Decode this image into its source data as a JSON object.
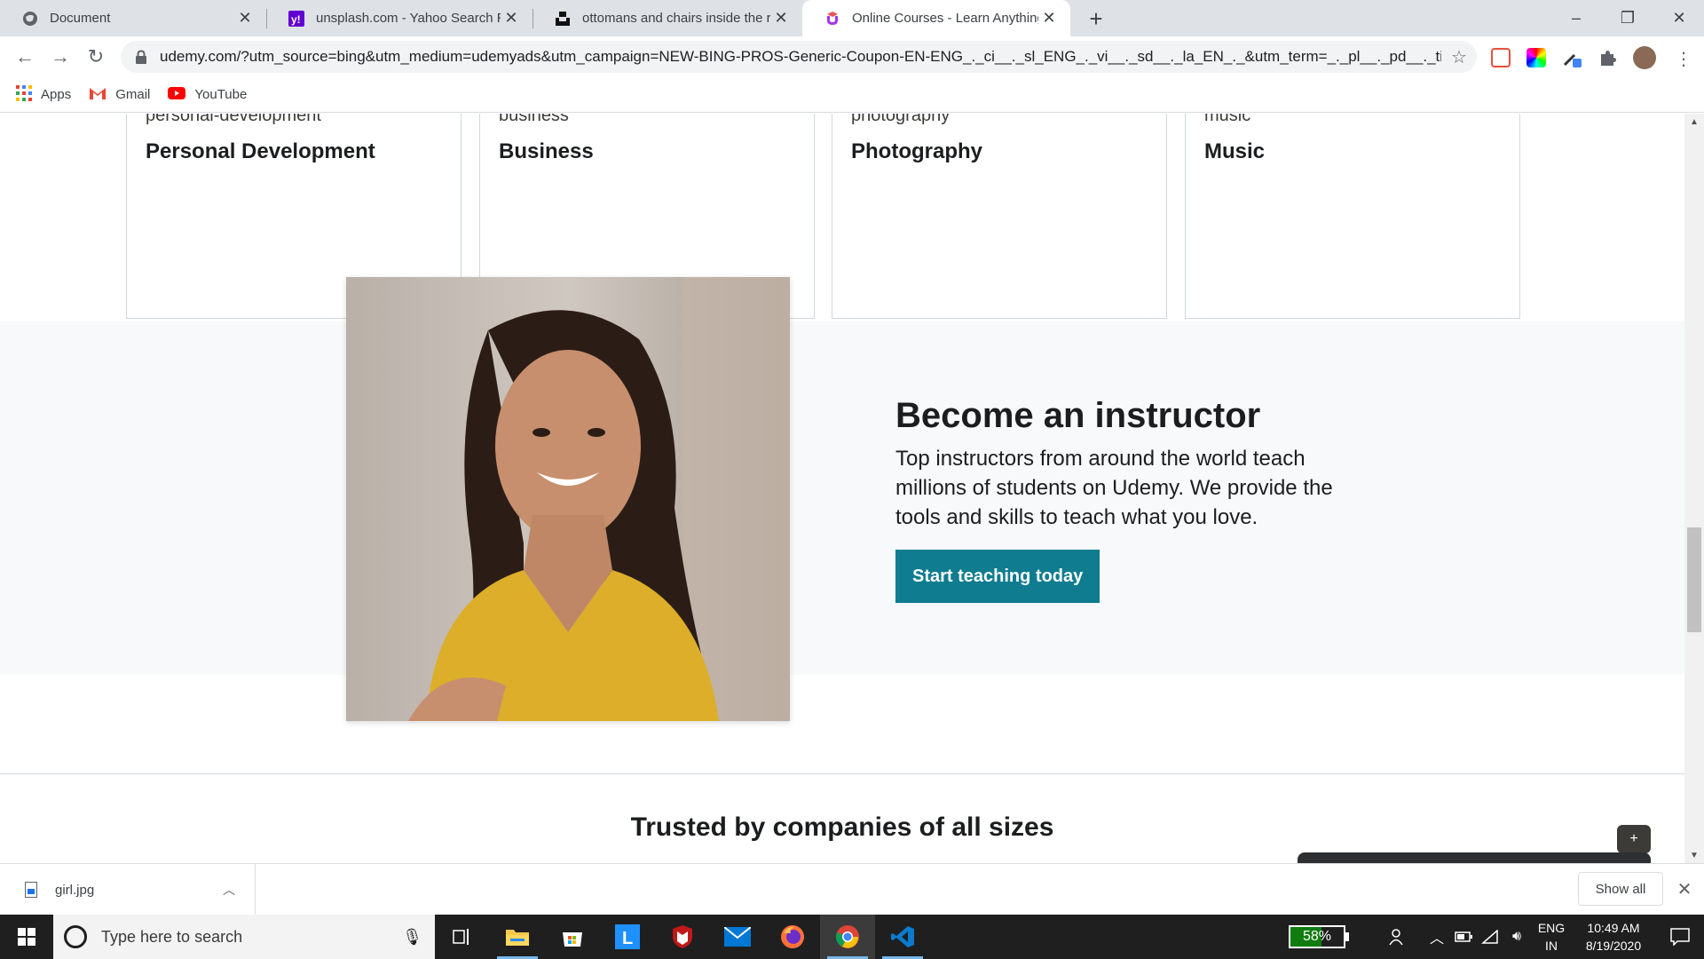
{
  "browser": {
    "tabs": [
      {
        "title": "Document",
        "favicon": "globe-icon",
        "active": false
      },
      {
        "title": "unsplash.com - Yahoo Search Res",
        "favicon": "yahoo-icon",
        "active": false
      },
      {
        "title": "ottomans and chairs inside the ro",
        "favicon": "unsplash-icon",
        "active": false
      },
      {
        "title": "Online Courses - Learn Anything,",
        "favicon": "udemy-icon",
        "active": true
      }
    ],
    "new_tab": "+",
    "window_controls": {
      "minimize": "–",
      "restore": "❐",
      "close": "✕"
    },
    "url": "udemy.com/?utm_source=bing&utm_medium=udemyads&utm_campaign=NEW-BING-PROS-Generic-Coupon-EN-ENG_._ci__._sl_ENG_._vi__._sd__._la_EN_._&utm_term=_._pl__._pd__._ti_...",
    "bookmarks": [
      {
        "label": "Apps",
        "icon": "apps-grid-icon"
      },
      {
        "label": "Gmail",
        "icon": "gmail-icon"
      },
      {
        "label": "YouTube",
        "icon": "youtube-icon"
      }
    ]
  },
  "categories": [
    {
      "cutoff": "personal-development",
      "name": "Personal Development"
    },
    {
      "cutoff": "business",
      "name": "Business"
    },
    {
      "cutoff": "photography",
      "name": "Photography"
    },
    {
      "cutoff": "music",
      "name": "Music"
    }
  ],
  "instructor": {
    "title": "Become an instructor",
    "description": "Top instructors from around the world teach millions of students on Udemy. We provide the tools and skills to teach what you love.",
    "cta": "Start teaching today"
  },
  "trusted_heading": "Trusted by companies of all sizes",
  "fab_label": "+",
  "downloads": {
    "file": "girl.jpg",
    "show_all": "Show all"
  },
  "taskbar": {
    "search_placeholder": "Type here to search",
    "battery_percent": "58%",
    "battery_level": 0.58,
    "lang_top": "ENG",
    "lang_bottom": "IN",
    "time": "10:49 AM",
    "date": "8/19/2020"
  },
  "colors": {
    "udemy_teal": "#0f7c90",
    "band_bg": "#f7f9fa",
    "taskbar_bg": "#1f1f1f"
  }
}
